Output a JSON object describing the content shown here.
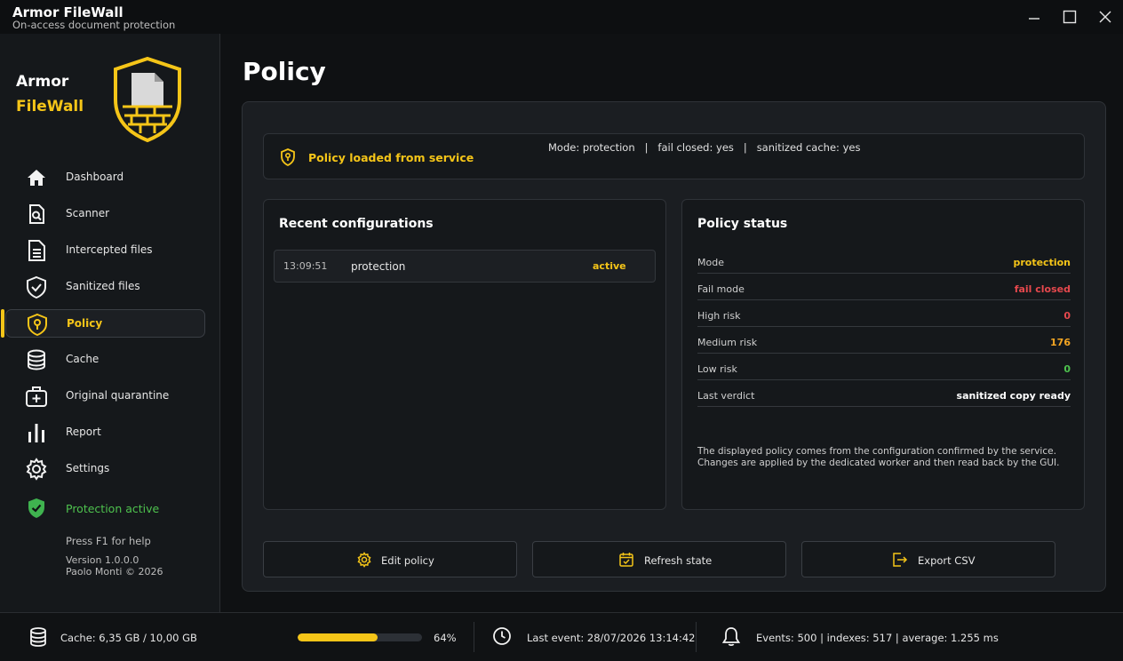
{
  "window": {
    "title": "Armor FileWall",
    "subtitle": "On-access document protection"
  },
  "brand": {
    "line1": "Armor",
    "line2": "FileWall"
  },
  "sidebar": {
    "items": [
      {
        "label": "Dashboard",
        "icon": "home-icon"
      },
      {
        "label": "Scanner",
        "icon": "scan-document-icon"
      },
      {
        "label": "Intercepted files",
        "icon": "file-text-icon"
      },
      {
        "label": "Sanitized files",
        "icon": "shield-check-icon"
      },
      {
        "label": "Policy",
        "icon": "shield-key-icon",
        "active": true
      },
      {
        "label": "Cache",
        "icon": "database-icon"
      },
      {
        "label": "Original quarantine",
        "icon": "medical-kit-icon"
      },
      {
        "label": "Report",
        "icon": "bar-chart-icon"
      },
      {
        "label": "Settings",
        "icon": "gear-icon"
      }
    ],
    "protection_label": "Protection active",
    "help": "Press F1 for help",
    "version": "Version 1.0.0.0",
    "author": "Paolo Monti © 2026"
  },
  "page": {
    "title": "Policy"
  },
  "banner": {
    "text": "Policy loaded from service",
    "info": "Mode: protection   |   fail closed: yes   |   sanitized cache: yes"
  },
  "recent": {
    "title": "Recent configurations",
    "rows": [
      {
        "time": "13:09:51",
        "mode": "protection",
        "state": "active"
      }
    ]
  },
  "status": {
    "title": "Policy status",
    "rows": [
      {
        "key": "Mode",
        "value": "protection",
        "color": "#f5c518"
      },
      {
        "key": "Fail mode",
        "value": "fail closed",
        "color": "#e5484d"
      },
      {
        "key": "High risk",
        "value": "0",
        "color": "#e5484d"
      },
      {
        "key": "Medium risk",
        "value": "176",
        "color": "#f5a623"
      },
      {
        "key": "Low risk",
        "value": "0",
        "color": "#4ec24e"
      },
      {
        "key": "Last verdict",
        "value": "sanitized copy ready",
        "color": "#ffffff"
      }
    ],
    "note_line1": "The displayed policy comes from the configuration confirmed by the service.",
    "note_line2": "Changes are applied by the dedicated worker and then read back by the GUI."
  },
  "actions": {
    "edit": "Edit policy",
    "refresh": "Refresh state",
    "export": "Export CSV"
  },
  "statusbar": {
    "cache": "Cache: 6,35 GB / 10,00 GB",
    "progress_fraction": 0.64,
    "progress_label": "64%",
    "last_event": "Last event: 28/07/2026 13:14:42",
    "events": "Events: 500  |  indexes: 517  |  average: 1.255 ms"
  },
  "colors": {
    "accent": "#f5c518",
    "danger": "#e5484d",
    "success": "#4ec24e",
    "warning": "#f5a623"
  }
}
